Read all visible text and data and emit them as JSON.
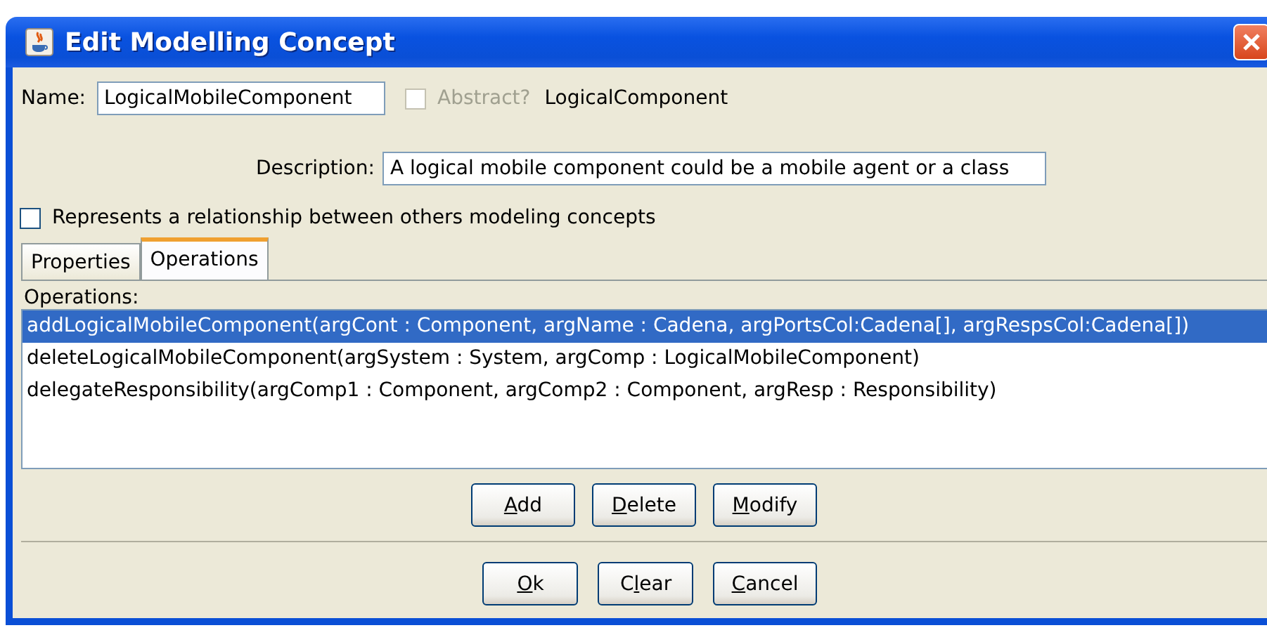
{
  "window": {
    "title": "Edit Modelling Concept"
  },
  "name": {
    "label": "Name:",
    "value": "LogicalMobileComponent"
  },
  "abstract": {
    "label": "Abstract?",
    "checked": false,
    "disabled": true
  },
  "parent": "LogicalComponent",
  "description": {
    "label": "Description:",
    "value": "A logical mobile component could be a mobile agent or a class"
  },
  "relationship": {
    "label": "Represents a relationship between others modeling concepts",
    "checked": false
  },
  "tabs": [
    {
      "label": "Properties",
      "selected": false
    },
    {
      "label": "Operations",
      "selected": true
    }
  ],
  "operations": {
    "label": "Operations:",
    "items": [
      {
        "text": "addLogicalMobileComponent(argCont : Component, argName : Cadena, argPortsCol:Cadena[], argRespsCol:Cadena[])",
        "selected": true
      },
      {
        "text": "deleteLogicalMobileComponent(argSystem : System, argComp : LogicalMobileComponent)",
        "selected": false
      },
      {
        "text": "delegateResponsibility(argComp1 : Component, argComp2 : Component, argResp : Responsibility)",
        "selected": false
      }
    ]
  },
  "list_buttons": [
    {
      "parts": [
        {
          "text": "A",
          "underlined": true
        },
        {
          "text": "dd",
          "underlined": false
        }
      ]
    },
    {
      "parts": [
        {
          "text": "D",
          "underlined": true
        },
        {
          "text": "elete",
          "underlined": false
        }
      ]
    },
    {
      "parts": [
        {
          "text": "M",
          "underlined": true
        },
        {
          "text": "odify",
          "underlined": false
        }
      ]
    }
  ],
  "dialog_buttons": [
    {
      "parts": [
        {
          "text": "O",
          "underlined": true
        },
        {
          "text": "k",
          "underlined": false
        }
      ]
    },
    {
      "parts": [
        {
          "text": "C",
          "underlined": false
        },
        {
          "text": "l",
          "underlined": true
        },
        {
          "text": "ear",
          "underlined": false
        }
      ]
    },
    {
      "parts": [
        {
          "text": "C",
          "underlined": true
        },
        {
          "text": "ancel",
          "underlined": false
        }
      ]
    }
  ]
}
